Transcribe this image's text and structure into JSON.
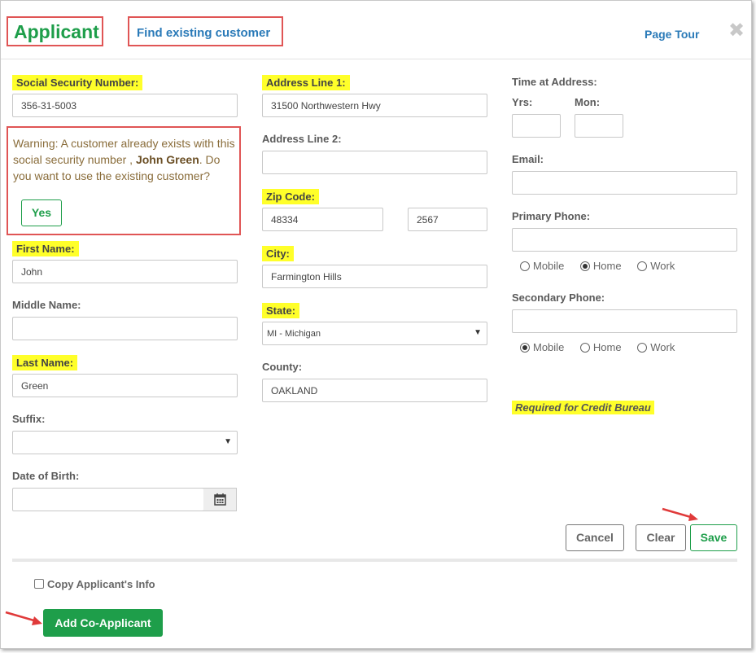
{
  "header": {
    "title": "Applicant",
    "find_existing": "Find existing customer",
    "page_tour": "Page Tour",
    "close_symbol": "✖"
  },
  "col1": {
    "ssn_label": "Social Security Number:",
    "ssn_value": "356-31-5003",
    "warning": {
      "text_before": "Warning: A customer already exists with this social security number ,",
      "name": "John Green",
      "text_after": ". Do you want to use the existing customer?",
      "yes_label": "Yes"
    },
    "first_name_label": "First Name:",
    "first_name_value": "John",
    "middle_name_label": "Middle Name:",
    "middle_name_value": "",
    "last_name_label": "Last Name:",
    "last_name_value": "Green",
    "suffix_label": "Suffix:",
    "suffix_value": "",
    "dob_label": "Date of Birth:",
    "dob_value": ""
  },
  "col2": {
    "address1_label": "Address Line 1:",
    "address1_value": "31500 Northwestern Hwy",
    "address2_label": "Address Line 2:",
    "address2_value": "",
    "zip_label": "Zip Code:",
    "zip_value": "48334",
    "zip_ext_value": "2567",
    "city_label": "City:",
    "city_value": "Farmington Hills",
    "state_label": "State:",
    "state_value": "MI - Michigan",
    "county_label": "County:",
    "county_value": "OAKLAND"
  },
  "col3": {
    "time_label": "Time at Address:",
    "yrs_label": "Yrs:",
    "mon_label": "Mon:",
    "yrs_value": "",
    "mon_value": "",
    "email_label": "Email:",
    "email_value": "",
    "primary_phone_label": "Primary Phone:",
    "primary_phone_value": "",
    "primary_phone_types": [
      "Mobile",
      "Home",
      "Work"
    ],
    "primary_phone_selected": "Home",
    "secondary_phone_label": "Secondary Phone:",
    "secondary_phone_value": "",
    "secondary_phone_types": [
      "Mobile",
      "Home",
      "Work"
    ],
    "secondary_phone_selected": "Mobile",
    "required_note": "Required for Credit Bureau"
  },
  "actions": {
    "cancel": "Cancel",
    "clear": "Clear",
    "save": "Save"
  },
  "footer": {
    "copy_info": "Copy Applicant's Info",
    "add_coapplicant": "Add Co-Applicant"
  },
  "colors": {
    "brand_green": "#1e9e4a",
    "link_blue": "#2a7ab8",
    "highlight_yellow": "#ffff2a",
    "annotation_red": "#e05555"
  }
}
